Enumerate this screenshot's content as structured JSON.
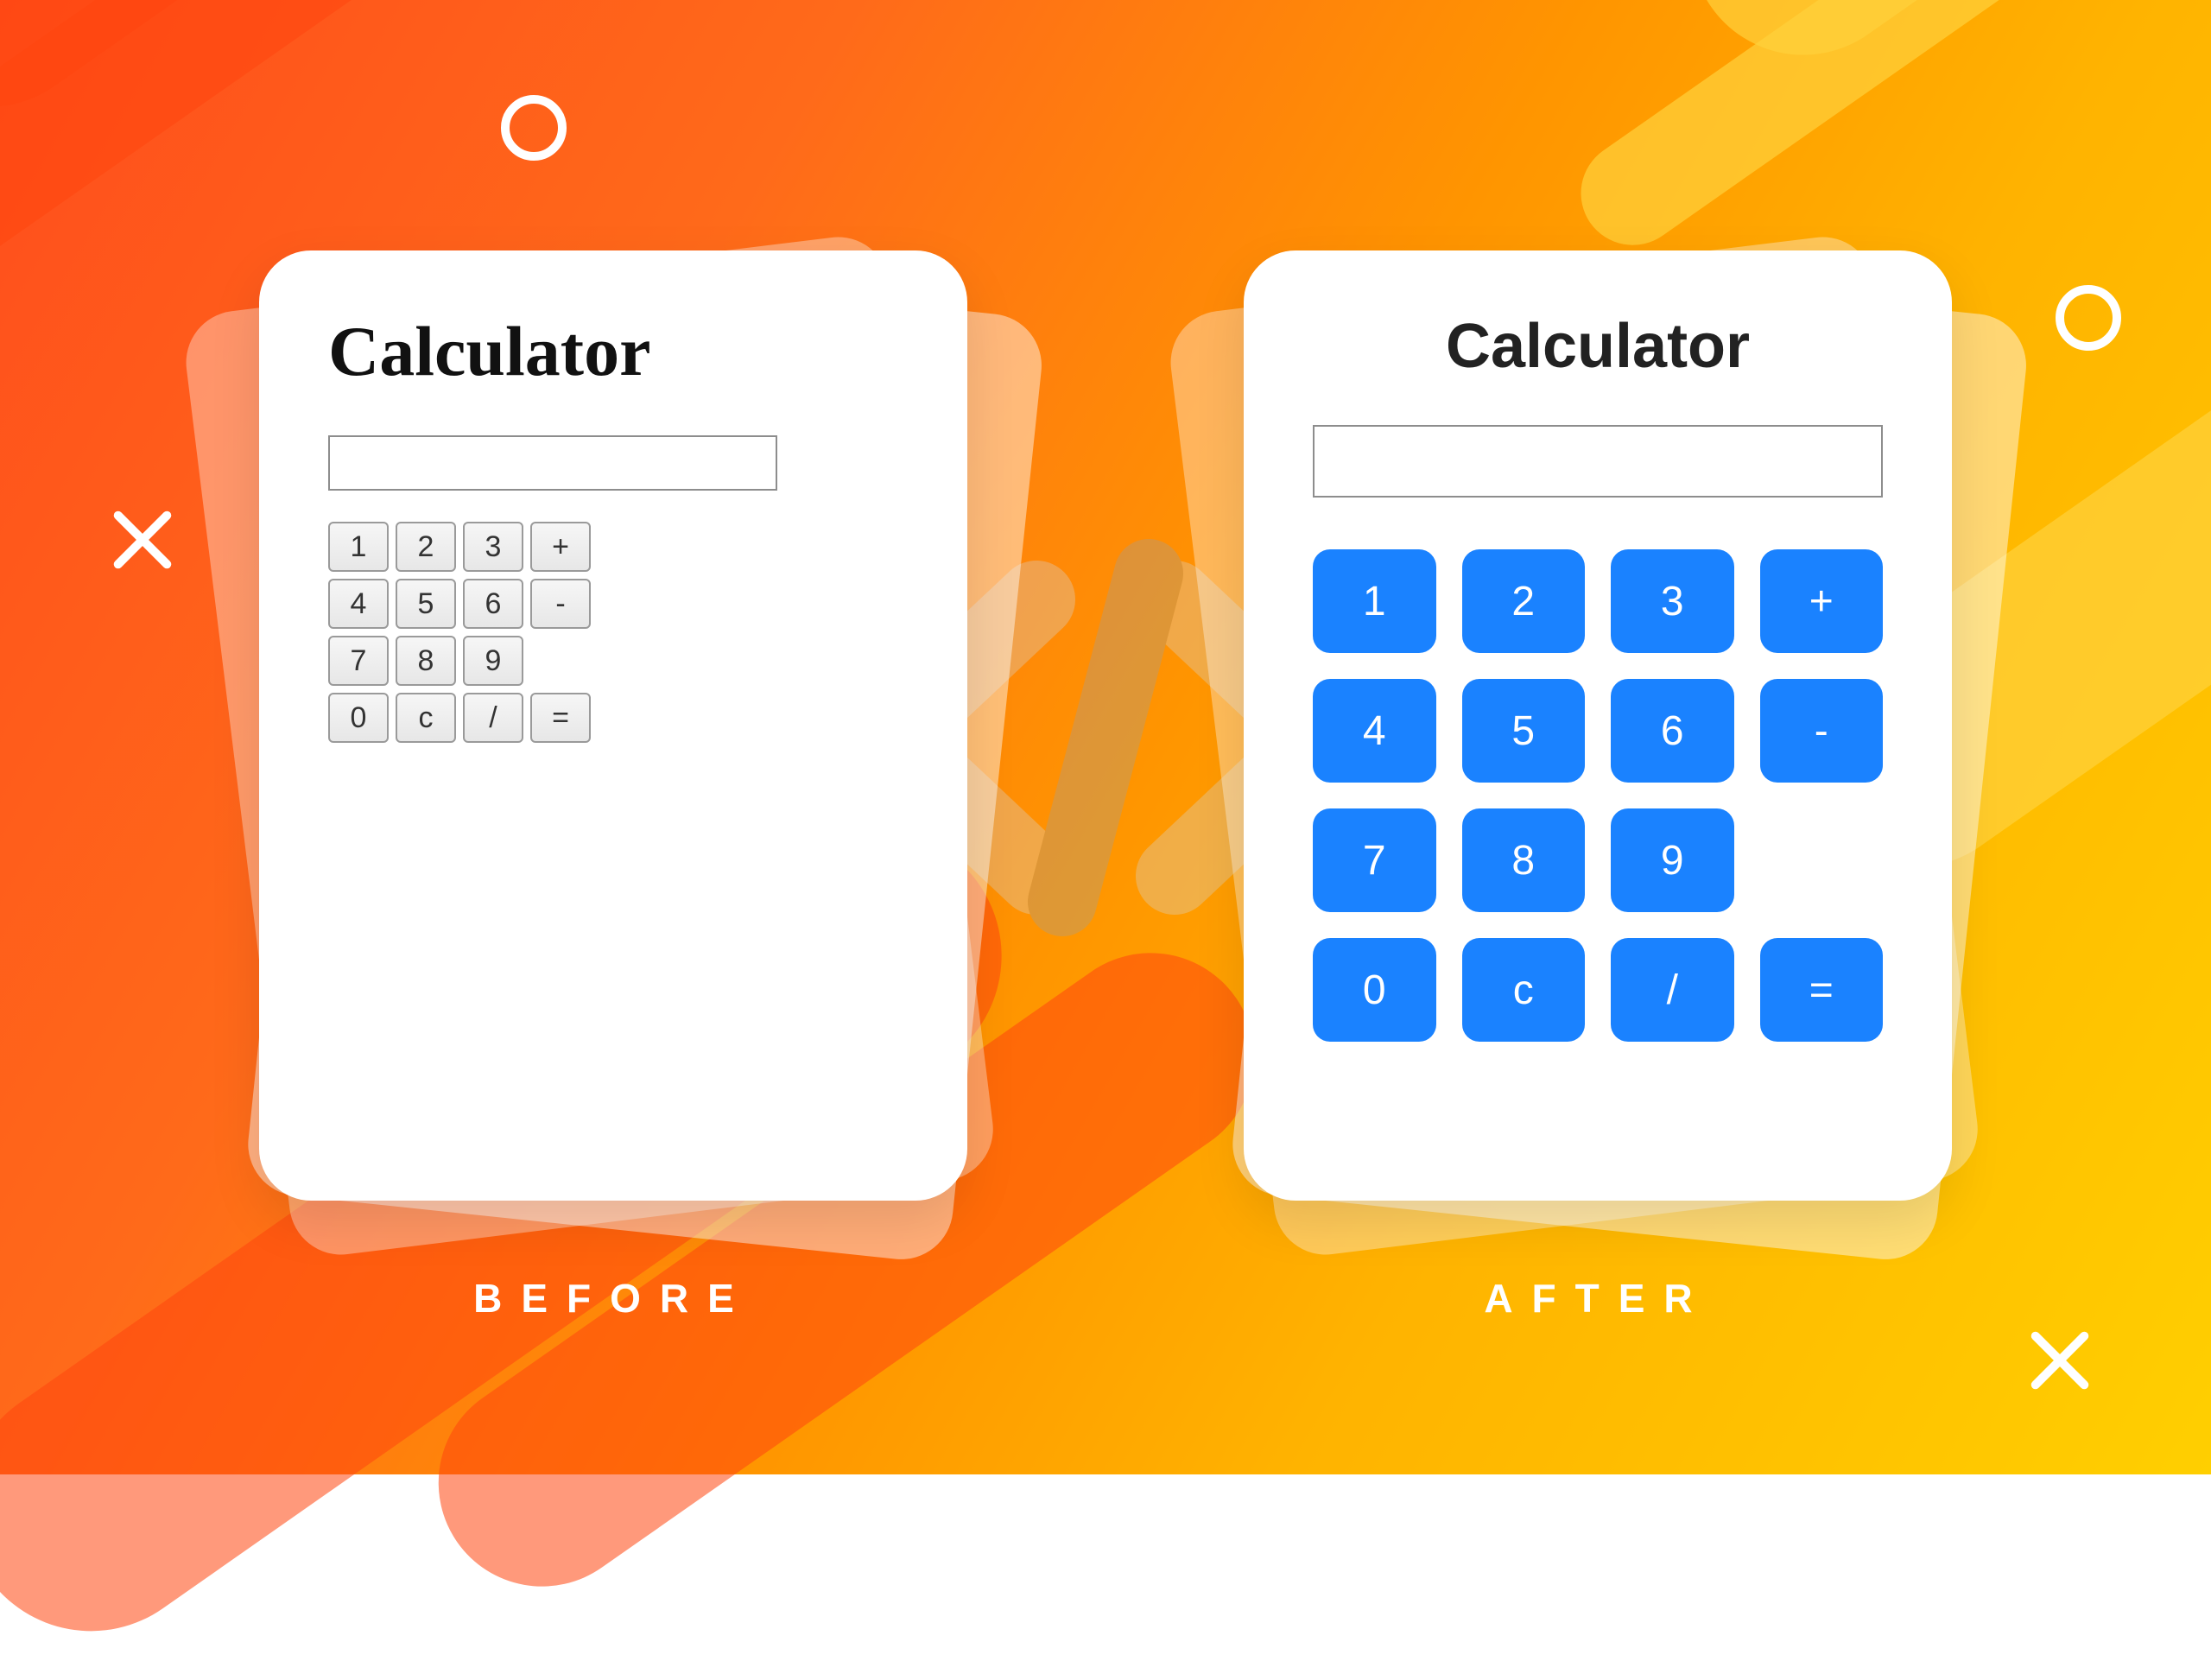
{
  "labels": {
    "before": "BEFORE",
    "after": "AFTER"
  },
  "before": {
    "title": "Calculator",
    "display_value": "",
    "keys": [
      "1",
      "2",
      "3",
      "+",
      "4",
      "5",
      "6",
      "-",
      "7",
      "8",
      "9",
      "",
      "0",
      "c",
      "/",
      "="
    ]
  },
  "after": {
    "title": "Calculator",
    "display_value": "",
    "keys": [
      "1",
      "2",
      "3",
      "+",
      "4",
      "5",
      "6",
      "-",
      "7",
      "8",
      "9",
      "",
      "0",
      "c",
      "/",
      "="
    ]
  },
  "colors": {
    "accent_button": "#1a82ff"
  }
}
